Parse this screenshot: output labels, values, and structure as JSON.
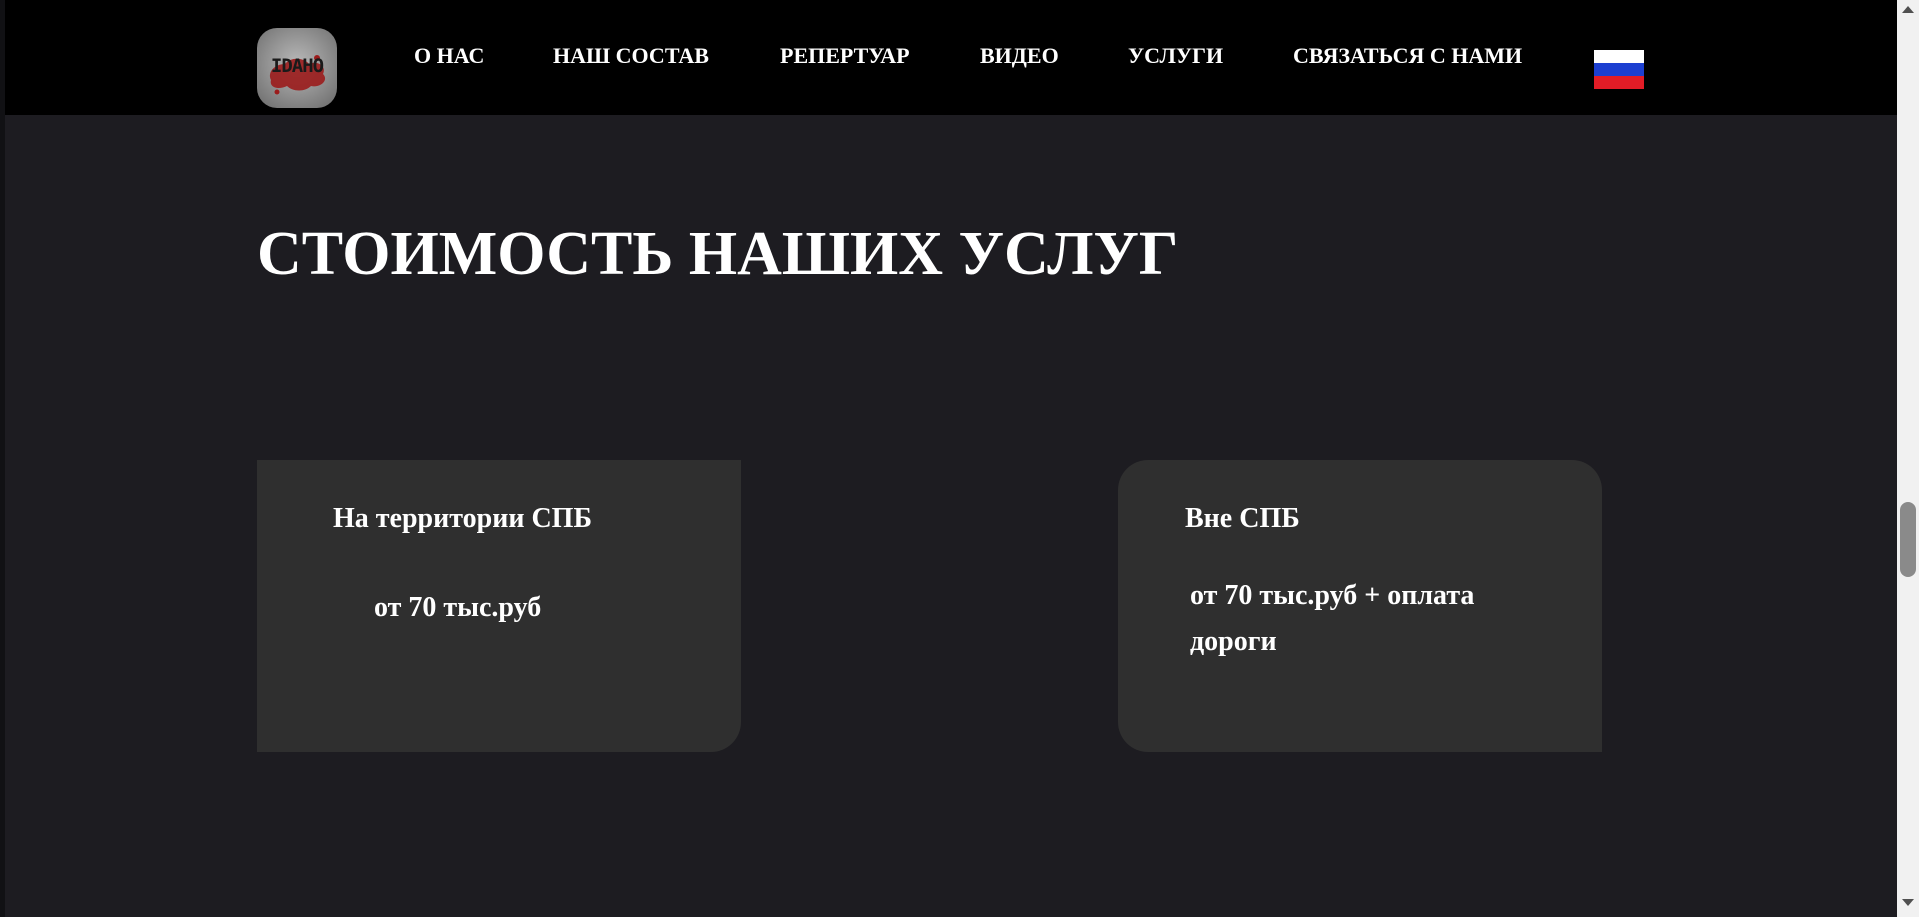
{
  "header": {
    "logo_text": "IDAHO",
    "nav": [
      {
        "label": "О НАС"
      },
      {
        "label": "НАШ СОСТАВ"
      },
      {
        "label": "РЕПЕРТУАР"
      },
      {
        "label": "ВИДЕО"
      },
      {
        "label": "УСЛУГИ"
      },
      {
        "label": "СВЯЗАТЬСЯ С НАМИ"
      }
    ],
    "language_flag_icon": "russian-flag-icon",
    "flag_colors": [
      "#ffffff",
      "#1c3fd1",
      "#e21c26"
    ]
  },
  "main": {
    "title": "СТОИМОСТЬ НАШИХ УСЛУГ",
    "cards": [
      {
        "title": "На территории СПБ",
        "price": "от 70 тыс.руб"
      },
      {
        "title": "Вне СПБ",
        "price": "от 70 тыс.руб + оплата дороги"
      }
    ]
  },
  "colors": {
    "background": "#1d1c21",
    "header": "#000000",
    "card": "#2f2f2f",
    "text": "#ffffff"
  }
}
